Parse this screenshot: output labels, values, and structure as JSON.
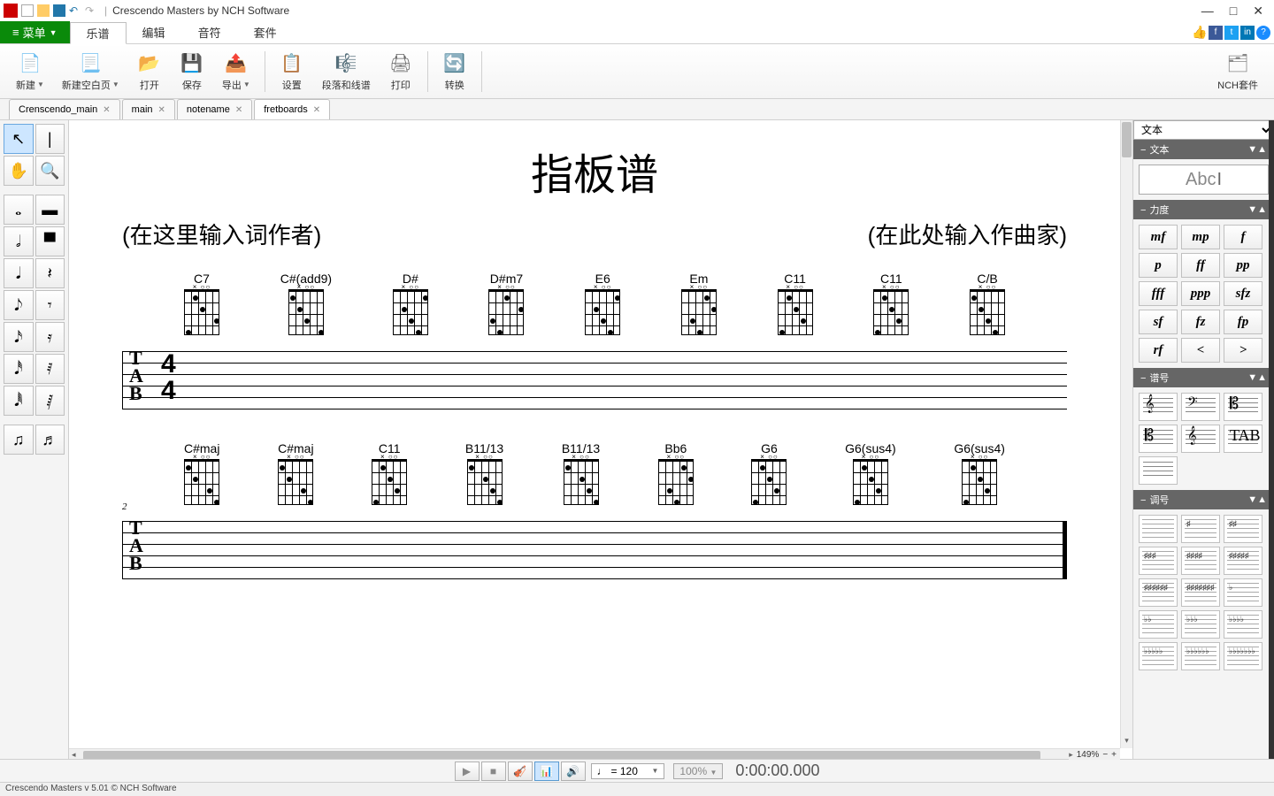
{
  "app": {
    "title": "Crescendo Masters by NCH Software"
  },
  "window": {
    "min": "—",
    "max": "□",
    "close": "✕"
  },
  "menu": {
    "button": "菜单",
    "tabs": [
      "乐谱",
      "编辑",
      "音符",
      "套件"
    ],
    "active_index": 0
  },
  "ribbon": {
    "items": [
      "新建",
      "新建空白页",
      "打开",
      "保存",
      "导出",
      "设置",
      "段落和线谱",
      "打印",
      "转换"
    ],
    "suite": "NCH套件"
  },
  "doctabs": {
    "items": [
      "Crenscendo_main",
      "main",
      "notename",
      "fretboards"
    ],
    "active_index": 3
  },
  "score": {
    "title": "指板谱",
    "lyricist": "(在这里输入词作者)",
    "composer": "(在此处输入作曲家)",
    "row1": [
      "C7",
      "C#(add9)",
      "D#",
      "D#m7",
      "E6",
      "Em",
      "C11",
      "C11",
      "C/B"
    ],
    "row2": [
      "C#maj",
      "C#maj",
      "C11",
      "B11/13",
      "B11/13",
      "Bb6",
      "G6",
      "G6(sus4)",
      "G6(sus4)"
    ],
    "tab_letters": "T\nA\nB",
    "timesig_top": "4",
    "timesig_bot": "4",
    "bar2": "2"
  },
  "right": {
    "combo": "文本",
    "sec_text": "文本",
    "text_btn": "Abc",
    "sec_dyn": "力度",
    "dynamics": [
      "mf",
      "mp",
      "f",
      "p",
      "ff",
      "pp",
      "fff",
      "ppp",
      "sfz",
      "sf",
      "fz",
      "fp",
      "rf",
      "<",
      ">"
    ],
    "sec_clef": "谱号",
    "sec_key": "调号",
    "tri": "▼▲"
  },
  "transport": {
    "tempo": "= 120",
    "pct": "100%",
    "time": "0:00:00.000"
  },
  "zoom": {
    "value": "149%",
    "minus": "−",
    "plus": "+"
  },
  "status": "Crescendo Masters v 5.01 © NCH Software"
}
